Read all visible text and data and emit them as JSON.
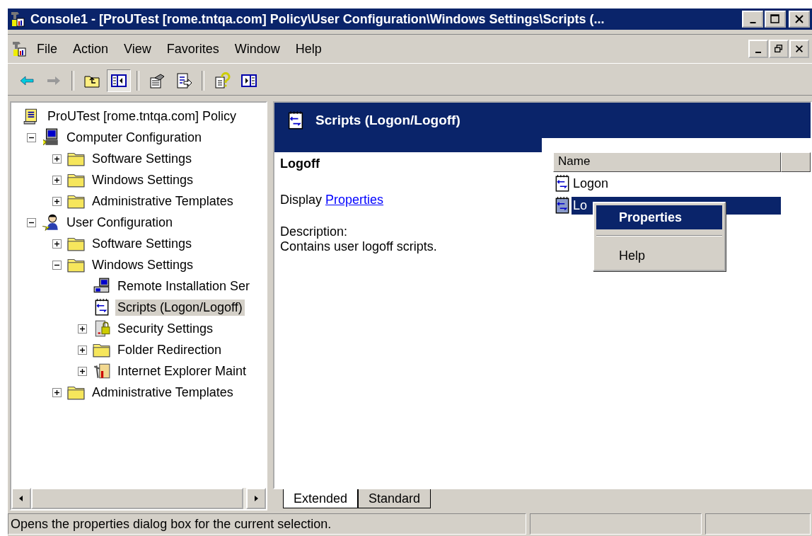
{
  "window": {
    "title": "Console1 - [ProUTest [rome.tntqa.com] Policy\\User Configuration\\Windows Settings\\Scripts (..."
  },
  "menu_bar": [
    "File",
    "Action",
    "View",
    "Favorites",
    "Window",
    "Help"
  ],
  "toolbar": [
    {
      "kind": "back",
      "disabled": false,
      "pressed": false
    },
    {
      "kind": "forward",
      "disabled": true,
      "pressed": false
    },
    {
      "kind": "separator"
    },
    {
      "kind": "up",
      "pressed": false
    },
    {
      "kind": "tree",
      "pressed": true
    },
    {
      "kind": "separator"
    },
    {
      "kind": "properties",
      "pressed": false
    },
    {
      "kind": "export",
      "pressed": false
    },
    {
      "kind": "separator"
    },
    {
      "kind": "help",
      "pressed": false
    },
    {
      "kind": "actionpane",
      "pressed": false
    }
  ],
  "tree": [
    {
      "label": "ProUTest [rome.tntqa.com] Policy",
      "kind": "policy",
      "selected": false,
      "children": [
        {
          "label": "Computer Configuration",
          "kind": "computer",
          "expanded": true,
          "selected": false,
          "children": [
            {
              "label": "Software Settings",
              "kind": "folder",
              "expanded": false,
              "selected": false
            },
            {
              "label": "Windows Settings",
              "kind": "folder",
              "expanded": false,
              "selected": false
            },
            {
              "label": "Administrative Templates",
              "kind": "folder",
              "expanded": false,
              "selected": false
            }
          ]
        },
        {
          "label": "User Configuration",
          "kind": "user",
          "expanded": true,
          "selected": false,
          "children": [
            {
              "label": "Software Settings",
              "kind": "folder",
              "expanded": false,
              "selected": false
            },
            {
              "label": "Windows Settings",
              "kind": "folder",
              "expanded": true,
              "selected": false,
              "children": [
                {
                  "label": "Remote Installation Ser",
                  "kind": "remote",
                  "selected": false
                },
                {
                  "label": "Scripts (Logon/Logoff)",
                  "kind": "script",
                  "selected": true
                },
                {
                  "label": "Security Settings",
                  "kind": "security",
                  "expanded": false,
                  "selected": false
                },
                {
                  "label": "Folder Redirection",
                  "kind": "folder",
                  "expanded": false,
                  "selected": false
                },
                {
                  "label": "Internet Explorer Maint",
                  "kind": "tools",
                  "expanded": false,
                  "selected": false
                }
              ]
            },
            {
              "label": "Administrative Templates",
              "kind": "folder",
              "expanded": false,
              "selected": false
            }
          ]
        }
      ]
    }
  ],
  "details": {
    "title": "Scripts (Logon/Logoff)",
    "heading": "Logoff",
    "action_prefix": "Display",
    "action_link": "Properties",
    "description_label": "Description:",
    "description": "Contains user logoff scripts."
  },
  "list": {
    "columns": [
      "Name"
    ],
    "rows": [
      {
        "name": "Logon",
        "selected": false
      },
      {
        "name": "Lo",
        "selected": true
      }
    ]
  },
  "context_menu": [
    {
      "kind": "item",
      "label": "Properties",
      "selected": true,
      "default": true
    },
    {
      "kind": "separator"
    },
    {
      "kind": "item",
      "label": "Help",
      "selected": false,
      "default": false
    }
  ],
  "view_tabs": [
    {
      "label": "Extended",
      "selected": true
    },
    {
      "label": "Standard",
      "selected": false
    }
  ],
  "status_bar": {
    "text": "Opens the properties dialog box for the current selection."
  }
}
